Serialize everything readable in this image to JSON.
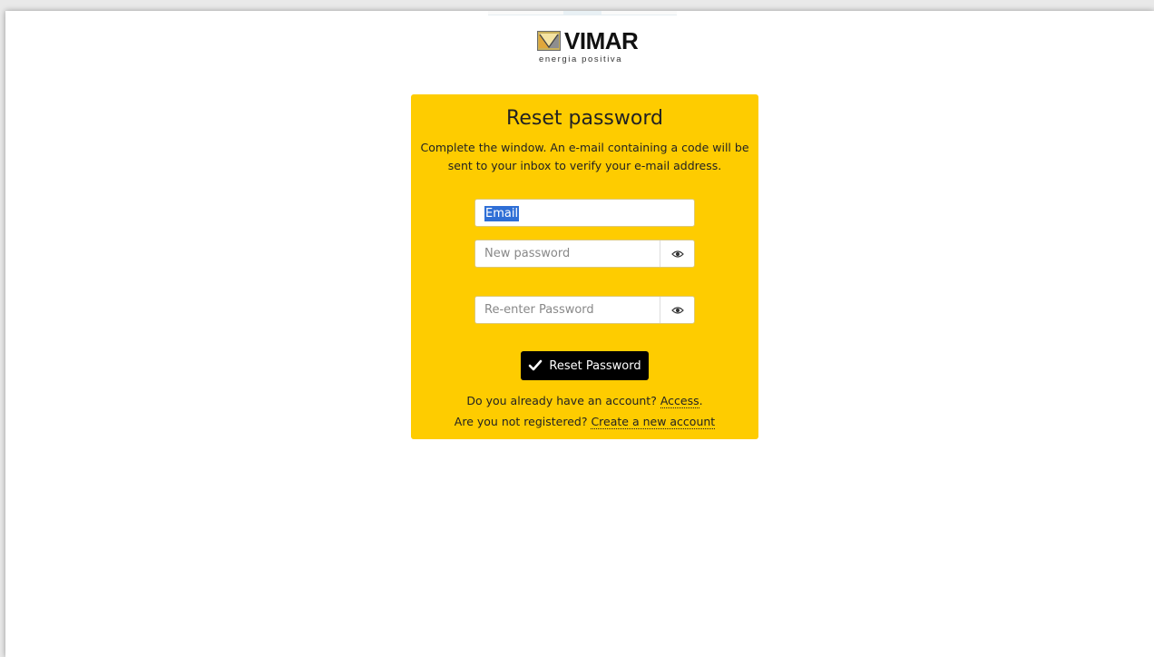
{
  "brand": {
    "name": "VIMAR",
    "tagline": "energia positiva"
  },
  "form": {
    "title": "Reset password",
    "description": "Complete the window. An e-mail containing a code will be sent to your inbox to verify your e-mail address.",
    "email": {
      "value": "Email",
      "placeholder": "Email"
    },
    "new_password": {
      "value": "",
      "placeholder": "New password"
    },
    "confirm_password": {
      "value": "",
      "placeholder": "Re-enter Password"
    },
    "submit_label": "Reset Password",
    "have_account_prompt": "Do you already have an account?",
    "access_link": "Access",
    "not_registered_prompt": "Are you not registered?",
    "create_account_link": "Create a new account"
  },
  "icons": {
    "show_password": "eye-icon",
    "submit": "check-icon",
    "logo": "vimar-logo-mark"
  },
  "colors": {
    "card_background": "#fecc00",
    "button_background": "#000000",
    "selection": "#2f6fd6"
  }
}
